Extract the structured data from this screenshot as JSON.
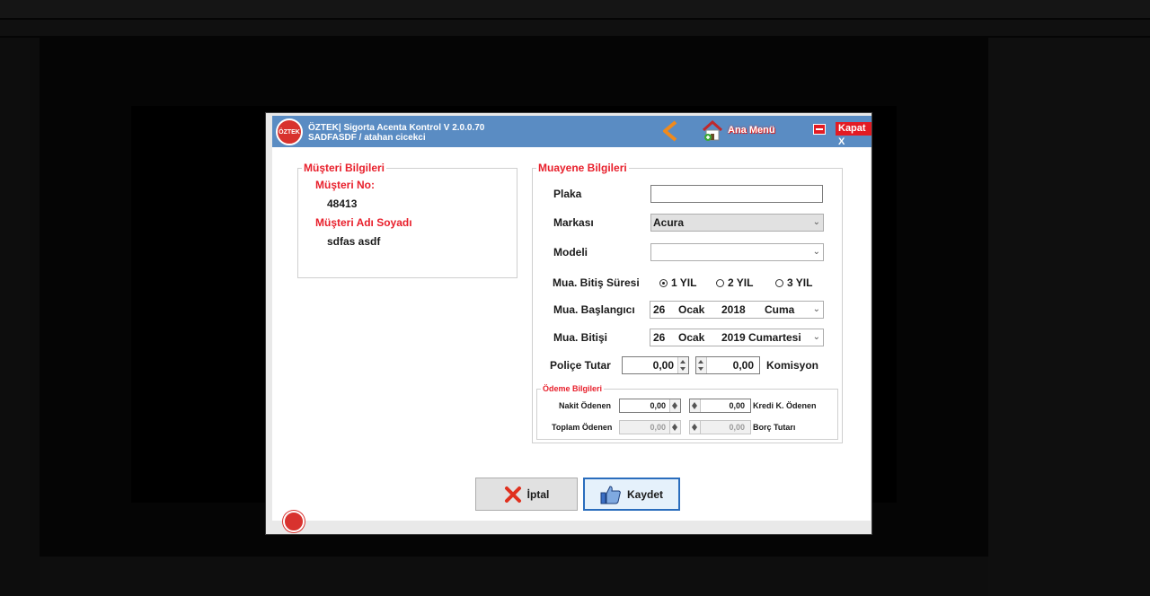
{
  "window": {
    "title": "ÖZTEK| Sigorta Acenta Kontrol V 2.0.0.70",
    "subtitle": "SADFASDF / atahan cicekci",
    "logo_text": "ÖZTEK",
    "main_menu_label": "Ana Menü",
    "close_label": "Kapat X"
  },
  "customer": {
    "legend": "Müşteri Bilgileri",
    "number_label": "Müşteri No:",
    "number_value": "48413",
    "name_label": "Müşteri Adı Soyadı",
    "name_value": "sdfas asdf"
  },
  "inspection": {
    "legend": "Muayene Bilgileri",
    "plate_label": "Plaka",
    "plate_value": "",
    "brand_label": "Markası",
    "brand_value": "Acura",
    "model_label": "Modeli",
    "model_value": "",
    "duration_label": "Mua. Bitiş Süresi",
    "duration_options": [
      "1 YIL",
      "2 YIL",
      "3 YIL"
    ],
    "duration_selected": "1 YIL",
    "start_label": "Mua. Başlangıcı",
    "start_date": {
      "day": "26",
      "month": "Ocak",
      "year": "2018",
      "weekday": "Cuma"
    },
    "end_label": "Mua. Bitişi",
    "end_date": {
      "day": "26",
      "month": "Ocak",
      "year": "2019",
      "weekday": "Cumartesi"
    },
    "policy_label": "Poliçe Tutar",
    "policy_value": "0,00",
    "commission_value": "0,00",
    "commission_label": "Komisyon"
  },
  "payment": {
    "legend": "Ödeme Bilgileri",
    "cash_label": "Nakit Ödenen",
    "cash_value": "0,00",
    "credit_value": "0,00",
    "credit_label": "Kredi K. Ödenen",
    "total_label": "Toplam Ödenen",
    "total_value": "0,00",
    "debt_value": "0,00",
    "debt_label": "Borç Tutarı"
  },
  "actions": {
    "cancel_label": "İptal",
    "save_label": "Kaydet"
  },
  "colors": {
    "titlebar": "#5a8cc3",
    "accent_red": "#e8202c",
    "primary_border": "#2a6dbd"
  }
}
